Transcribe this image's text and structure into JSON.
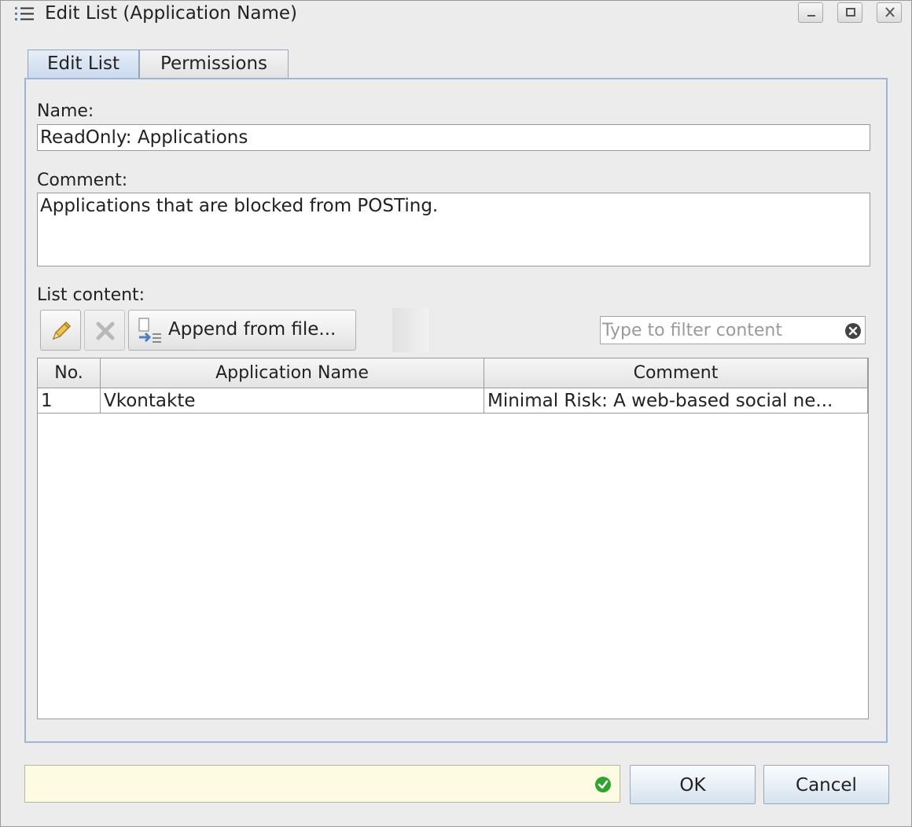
{
  "window": {
    "title": "Edit List (Application Name)",
    "icon": "list-icon"
  },
  "tabs": [
    {
      "label": "Edit List",
      "active": true
    },
    {
      "label": "Permissions",
      "active": false
    }
  ],
  "form": {
    "name_label": "Name:",
    "name_value": "ReadOnly: Applications",
    "comment_label": "Comment:",
    "comment_value": "Applications that are blocked from POSTing.",
    "list_content_label": "List content:"
  },
  "toolbar": {
    "edit_icon": "pencil-icon",
    "delete_icon": "delete-x-icon",
    "append_label": "Append from file...",
    "append_icon": "append-file-icon",
    "filter_placeholder": "Type to filter content",
    "filter_value": ""
  },
  "table": {
    "columns": [
      "No.",
      "Application Name",
      "Comment"
    ],
    "rows": [
      {
        "no": "1",
        "name": "Vkontakte",
        "comment": "Minimal Risk: A web-based social ne..."
      }
    ]
  },
  "footer": {
    "status_text": "",
    "status_icon": "check-circle-icon",
    "ok_label": "OK",
    "cancel_label": "Cancel"
  },
  "colors": {
    "tab_active": "#c9d9ec",
    "panel_border": "#9bb6d6",
    "status_bg": "#fdfce2",
    "ok_green": "#2fa52f"
  }
}
